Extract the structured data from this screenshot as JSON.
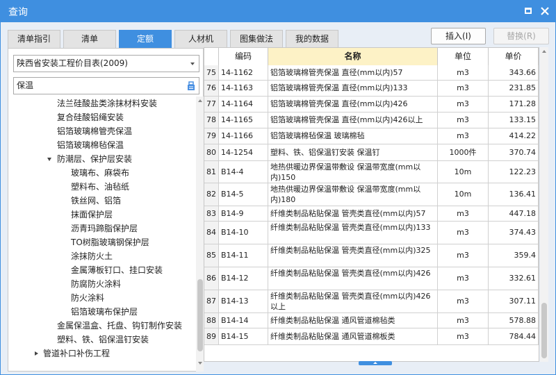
{
  "window": {
    "title": "查询"
  },
  "tabs": [
    {
      "label": "清单指引",
      "active": false
    },
    {
      "label": "清单",
      "active": false
    },
    {
      "label": "定额",
      "active": true
    },
    {
      "label": "人材机",
      "active": false
    },
    {
      "label": "图集做法",
      "active": false
    },
    {
      "label": "我的数据",
      "active": false
    }
  ],
  "actions": {
    "insert_label": "插入(I)",
    "replace_label": "替换(R)"
  },
  "left": {
    "library": "陕西省安装工程价目表(2009)",
    "search_value": "保温",
    "tree": [
      {
        "label": "法兰硅酸盐类涂抹材料安装",
        "level": 1,
        "toggle": ""
      },
      {
        "label": "复合硅酸铝绳安装",
        "level": 1,
        "toggle": ""
      },
      {
        "label": "铝箔玻璃棉管壳保温",
        "level": 1,
        "toggle": ""
      },
      {
        "label": "铝箔玻璃棉毡保温",
        "level": 1,
        "toggle": ""
      },
      {
        "label": "防潮层、保护层安装",
        "level": 1,
        "toggle": "expanded"
      },
      {
        "label": "玻璃布、麻袋布",
        "level": 2,
        "toggle": ""
      },
      {
        "label": "塑料布、油毡纸",
        "level": 2,
        "toggle": ""
      },
      {
        "label": "铁丝网、铝箔",
        "level": 2,
        "toggle": ""
      },
      {
        "label": "抹面保护层",
        "level": 2,
        "toggle": ""
      },
      {
        "label": "沥青玛蹄脂保护层",
        "level": 2,
        "toggle": ""
      },
      {
        "label": "TO树脂玻璃钢保护层",
        "level": 2,
        "toggle": ""
      },
      {
        "label": "涂抹防火土",
        "level": 2,
        "toggle": ""
      },
      {
        "label": "金属薄板钉口、挂口安装",
        "level": 2,
        "toggle": ""
      },
      {
        "label": "防腐防火涂料",
        "level": 2,
        "toggle": ""
      },
      {
        "label": "防火涂料",
        "level": 2,
        "toggle": ""
      },
      {
        "label": "铝箔玻璃布保护层",
        "level": 2,
        "toggle": ""
      },
      {
        "label": "金属保温盒、托盘、钩钉制作安装",
        "level": 1,
        "toggle": ""
      },
      {
        "label": "塑料、铁、铝保温钉安装",
        "level": 1,
        "toggle": ""
      },
      {
        "label": "管道补口补伤工程",
        "level": 0,
        "toggle": "collapsed"
      }
    ]
  },
  "grid": {
    "columns": {
      "index": "",
      "code": "编码",
      "name": "名称",
      "unit": "单位",
      "price": "单价"
    },
    "rows": [
      {
        "idx": "75",
        "code": "14-1162",
        "name": "铝箔玻璃棉管壳保温 直径(mm以内)57",
        "unit": "m3",
        "price": "343.66"
      },
      {
        "idx": "76",
        "code": "14-1163",
        "name": "铝箔玻璃棉管壳保温 直径(mm以内)133",
        "unit": "m3",
        "price": "231.85"
      },
      {
        "idx": "77",
        "code": "14-1164",
        "name": "铝箔玻璃棉管壳保温 直径(mm以内)426",
        "unit": "m3",
        "price": "171.28"
      },
      {
        "idx": "78",
        "code": "14-1165",
        "name": "铝箔玻璃棉管壳保温 直径(mm以内)426以上",
        "unit": "m3",
        "price": "133.15"
      },
      {
        "idx": "79",
        "code": "14-1166",
        "name": "铝箔玻璃棉毡保温 玻璃棉毡",
        "unit": "m3",
        "price": "414.22"
      },
      {
        "idx": "80",
        "code": "14-1254",
        "name": "塑料、铁、铝保温钉安装 保温钉",
        "unit": "1000件",
        "price": "370.74"
      },
      {
        "idx": "81",
        "code": "B14-4",
        "name": "地热供暖边界保温带敷设 保温带宽度(mm以内)150",
        "unit": "10m",
        "price": "122.23"
      },
      {
        "idx": "82",
        "code": "B14-5",
        "name": "地热供暖边界保温带敷设 保温带宽度(mm以内)180",
        "unit": "10m",
        "price": "136.41"
      },
      {
        "idx": "83",
        "code": "B14-9",
        "name": "纤维类制品粘贴保温 管壳类直径(mm以内)57",
        "unit": "m3",
        "price": "447.18"
      },
      {
        "idx": "84",
        "code": "B14-10",
        "name": "纤维类制品粘贴保温 管壳类直径(mm以内)133",
        "unit": "m3",
        "price": "374.43"
      },
      {
        "idx": "85",
        "code": "B14-11",
        "name": "纤维类制品粘贴保温 管壳类直径(mm以内)325",
        "unit": "m3",
        "price": "359.4"
      },
      {
        "idx": "86",
        "code": "B14-12",
        "name": "纤维类制品粘贴保温 管壳类直径(mm以内)426",
        "unit": "m3",
        "price": "332.61"
      },
      {
        "idx": "87",
        "code": "B14-13",
        "name": "纤维类制品粘贴保温 管壳类直径(mm以内)426以上",
        "unit": "m3",
        "price": "307.11"
      },
      {
        "idx": "88",
        "code": "B14-14",
        "name": "纤维类制品粘贴保温 通风管道棉毡类",
        "unit": "m3",
        "price": "578.88"
      },
      {
        "idx": "89",
        "code": "B14-15",
        "name": "纤维类制品粘贴保温 通风管道棉板类",
        "unit": "m3",
        "price": "784.44"
      }
    ]
  },
  "colors": {
    "accent": "#3f8fe0",
    "header_highlight": "#fdf2c6"
  }
}
